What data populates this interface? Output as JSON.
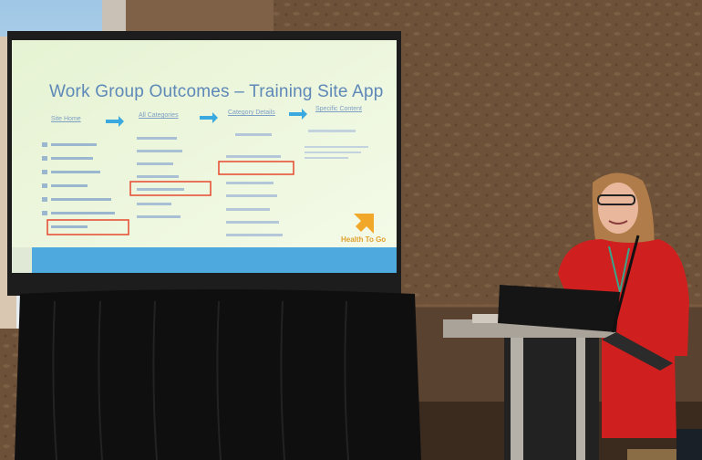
{
  "slide": {
    "title": "Work Group Outcomes – Training Site App",
    "steps": [
      "Site Home",
      "All Categories",
      "Category Details",
      "Specific Content"
    ],
    "brand": "Health To Go"
  },
  "colors": {
    "wall": "#6d5038",
    "screen": "#eef7d8",
    "slide_title": "#5d88b8",
    "arrow": "#39a9e0",
    "highlight": "#e5482e",
    "footer_bar": "#4da9de",
    "dress": "#cf1f1f"
  }
}
